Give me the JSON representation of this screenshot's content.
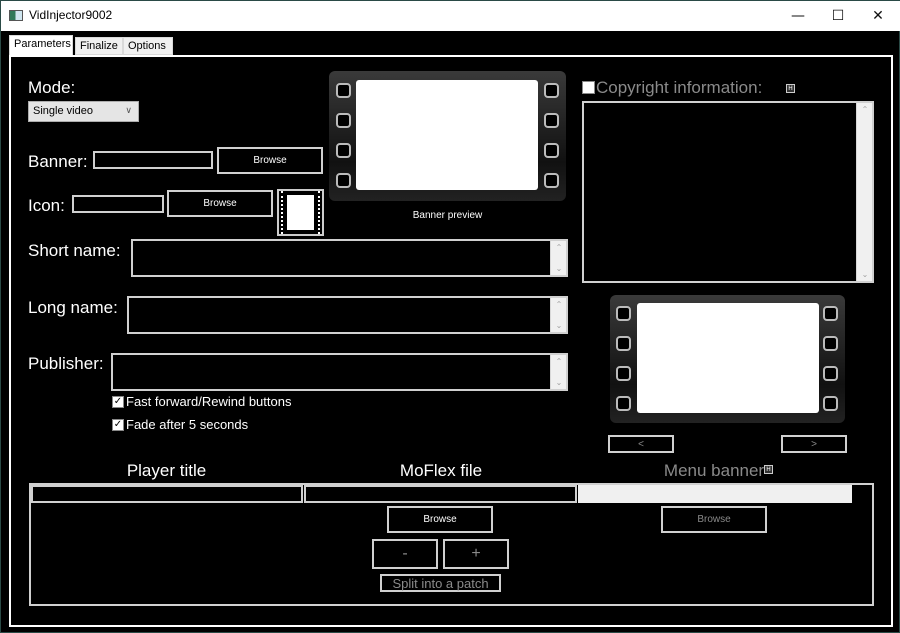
{
  "window": {
    "title": "VidInjector9002",
    "controls": {
      "minimize": "—",
      "maximize": "☐",
      "close": "✕"
    }
  },
  "tabs": [
    {
      "label": "Parameters",
      "active": true
    },
    {
      "label": "Finalize",
      "active": false
    },
    {
      "label": "Options",
      "active": false
    }
  ],
  "parameters": {
    "mode_label": "Mode:",
    "mode_value": "Single video",
    "banner_label": "Banner:",
    "banner_value": "",
    "banner_browse": "Browse",
    "icon_label": "Icon:",
    "icon_value": "",
    "icon_browse": "Browse",
    "banner_preview_label": "Banner preview",
    "short_name_label": "Short name:",
    "short_name_value": "",
    "long_name_label": "Long name:",
    "long_name_value": "",
    "publisher_label": "Publisher:",
    "publisher_value": "",
    "ffrw_label": "Fast forward/Rewind buttons",
    "ffrw_checked": true,
    "fade_label": "Fade after 5 seconds",
    "fade_checked": true,
    "copyright_label": "Copyright information:",
    "copyright_checked": false,
    "copyright_value": "",
    "help_glyph": "H",
    "prev_label": "<",
    "next_label": ">"
  },
  "video_table": {
    "col_player_title": "Player title",
    "col_moflex_file": "MoFlex file",
    "col_menu_banner": "Menu banner",
    "rows": [
      {
        "player_title": "",
        "moflex_file": "",
        "menu_banner": ""
      }
    ],
    "moflex_browse": "Browse",
    "menu_banner_browse": "Browse",
    "remove_label": "-",
    "add_label": "+",
    "split_label": "Split into a patch"
  },
  "colors": {
    "background": "#000000",
    "foreground": "#ffffff",
    "disabled": "#8a8a8a",
    "border": "#d0d0d0"
  }
}
